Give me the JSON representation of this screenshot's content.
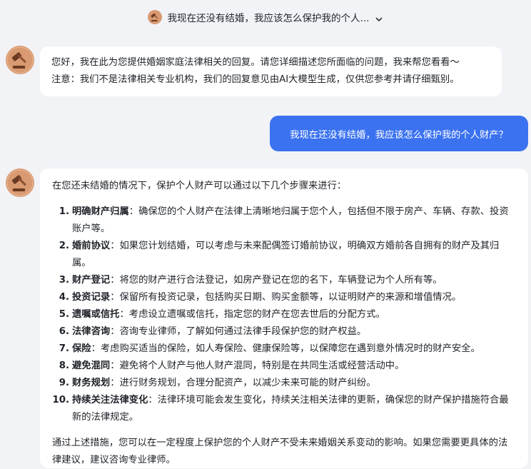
{
  "header": {
    "title": "我现在还没有结婚，我应该怎么保护我的个人...",
    "avatar_icon": "gavel-icon",
    "dropdown_icon": "chevron-down-icon"
  },
  "assistant_avatar_icon": "gavel-icon",
  "colors": {
    "page_bg": "#f2f3f7",
    "user_bubble": "#3b72f0",
    "avatar_bg": "#d99a72"
  },
  "messages": {
    "greeting": {
      "line1": "您好，我在此为您提供婚姻家庭法律相关的回复。请您详细描述您所面临的问题，我来帮您看看～",
      "line2": "注意：我们不是法律相关专业机构，我们的回复意见由AI大模型生成，仅供您参考并请仔细甄别。"
    },
    "user": {
      "text": "我现在还没有结婚，我应该怎么保护我的个人财产？"
    },
    "answer": {
      "intro": "在您还未结婚的情况下，保护个人财产可以通过以下几个步骤来进行：",
      "steps": [
        {
          "num": "1.",
          "title": "明确财产归属",
          "desc": "：确保您的个人财产在法律上清晰地归属于您个人，包括但不限于房产、车辆、存款、投资账户等。"
        },
        {
          "num": "2.",
          "title": "婚前协议",
          "desc": "：如果您计划结婚，可以考虑与未来配偶签订婚前协议，明确双方婚前各自拥有的财产及其归属。"
        },
        {
          "num": "3.",
          "title": "财产登记",
          "desc": "：将您的财产进行合法登记，如房产登记在您的名下，车辆登记为个人所有等。"
        },
        {
          "num": "4.",
          "title": "投资记录",
          "desc": "：保留所有投资记录，包括购买日期、购买金额等，以证明财产的来源和增值情况。"
        },
        {
          "num": "5.",
          "title": "遗嘱或信托",
          "desc": "：考虑设立遗嘱或信托，指定您的财产在您去世后的分配方式。"
        },
        {
          "num": "6.",
          "title": "法律咨询",
          "desc": "：咨询专业律师，了解如何通过法律手段保护您的财产权益。"
        },
        {
          "num": "7.",
          "title": "保险",
          "desc": "：考虑购买适当的保险，如人寿保险、健康保险等，以保障您在遇到意外情况时的财产安全。"
        },
        {
          "num": "8.",
          "title": "避免混同",
          "desc": "：避免将个人财产与他人财产混同，特别是在共同生活或经营活动中。"
        },
        {
          "num": "9.",
          "title": "财务规划",
          "desc": "：进行财务规划，合理分配资产，以减少未来可能的财产纠纷。"
        },
        {
          "num": "10.",
          "title": "持续关注法律变化",
          "desc": "：法律环境可能会发生变化，持续关注相关法律的更新，确保您的财产保护措施符合最新的法律规定。"
        }
      ],
      "conclusion": "通过上述措施，您可以在一定程度上保护您的个人财产不受未来婚姻关系变动的影响。如果您需要更具体的法律建议，建议咨询专业律师。"
    }
  }
}
